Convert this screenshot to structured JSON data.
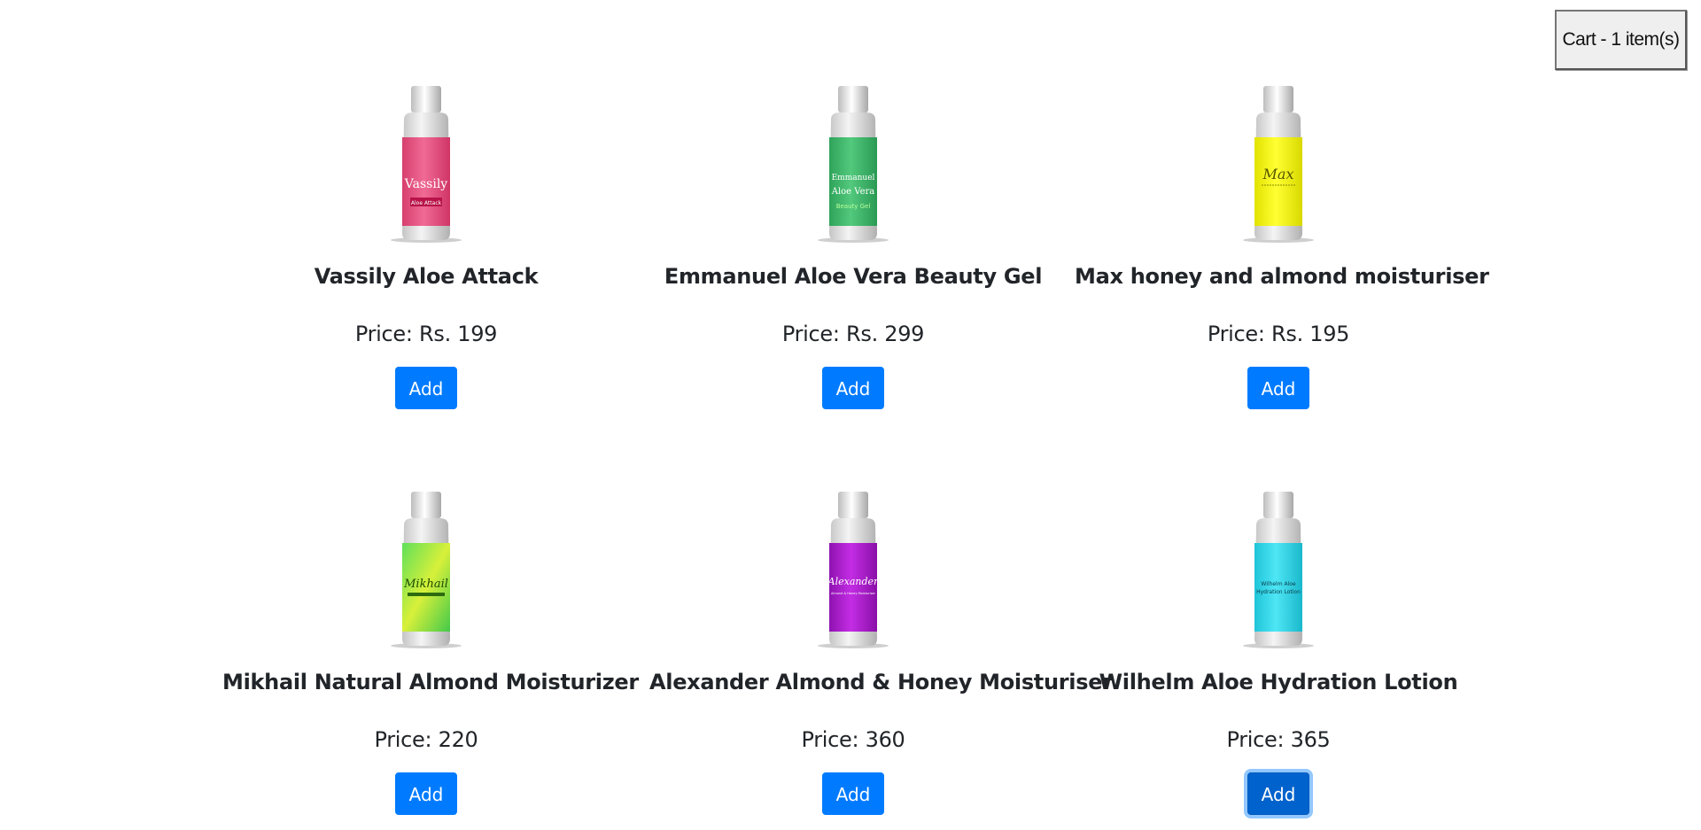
{
  "cart": {
    "label": "Cart - 1 item(s)"
  },
  "products": [
    {
      "name": "Vassily Aloe Attack",
      "price": "Price: Rs. 199",
      "add_label": "Add",
      "label_color": "#e8507f",
      "label_text_1": "Vassily",
      "label_text_2": "Aloe Attack"
    },
    {
      "name": "Emmanuel Aloe Vera Beauty Gel",
      "price": "Price: Rs. 299",
      "add_label": "Add",
      "label_color": "#3ebb6b",
      "label_text_1": "Emmanuel",
      "label_text_2": "Aloe Vera",
      "label_text_3": "Beauty Gel"
    },
    {
      "name": "Max honey and almond moisturiser",
      "price": "Price: Rs. 195",
      "add_label": "Add",
      "label_color": "#f2f20a",
      "label_text_1": "Max"
    },
    {
      "name": "Mikhail Natural Almond Moisturizer",
      "price": "Price: 220",
      "add_label": "Add",
      "label_color": "#9ee83a",
      "label_text_1": "Mikhail"
    },
    {
      "name": "Alexander Almond & Honey Moisturiser",
      "price": "Price: 360",
      "add_label": "Add",
      "label_color": "#b01ed0",
      "label_text_1": "Alexander",
      "label_text_2": "Almond & Honey Moisturiser"
    },
    {
      "name": "Wilhelm Aloe Hydration Lotion",
      "price": "Price: 365",
      "add_label": "Add",
      "label_color": "#2fd8ea",
      "label_text_1": "Wilhelm Aloe",
      "label_text_2": "Hydration Lotion"
    }
  ]
}
